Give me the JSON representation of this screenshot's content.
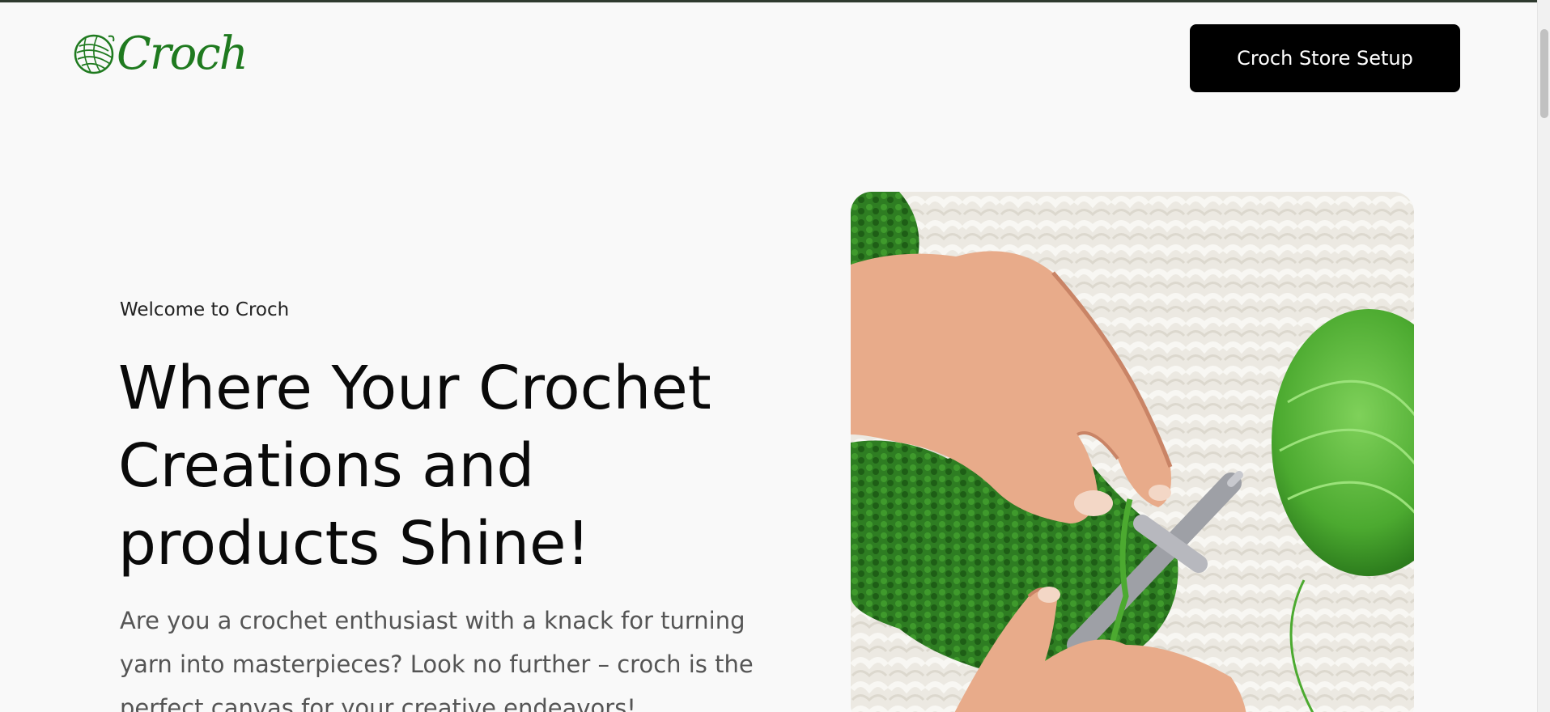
{
  "header": {
    "logo_text": "Croch",
    "cta_label": "Croch Store Setup"
  },
  "hero": {
    "eyebrow": "Welcome to Croch",
    "headline_lines": [
      "Where Your Crochet",
      "Creations and",
      "products Shine!"
    ],
    "intro": "Are you a crochet enthusiast with a knack for turning yarn into masterpieces? Look no further – croch is the perfect canvas for your creative endeavors!",
    "image_icon": "hands-knitting-green-yarn-photo"
  },
  "colors": {
    "brand_green": "#1f7a1f",
    "cta_background": "#000000",
    "page_background": "#f9f9f9"
  }
}
